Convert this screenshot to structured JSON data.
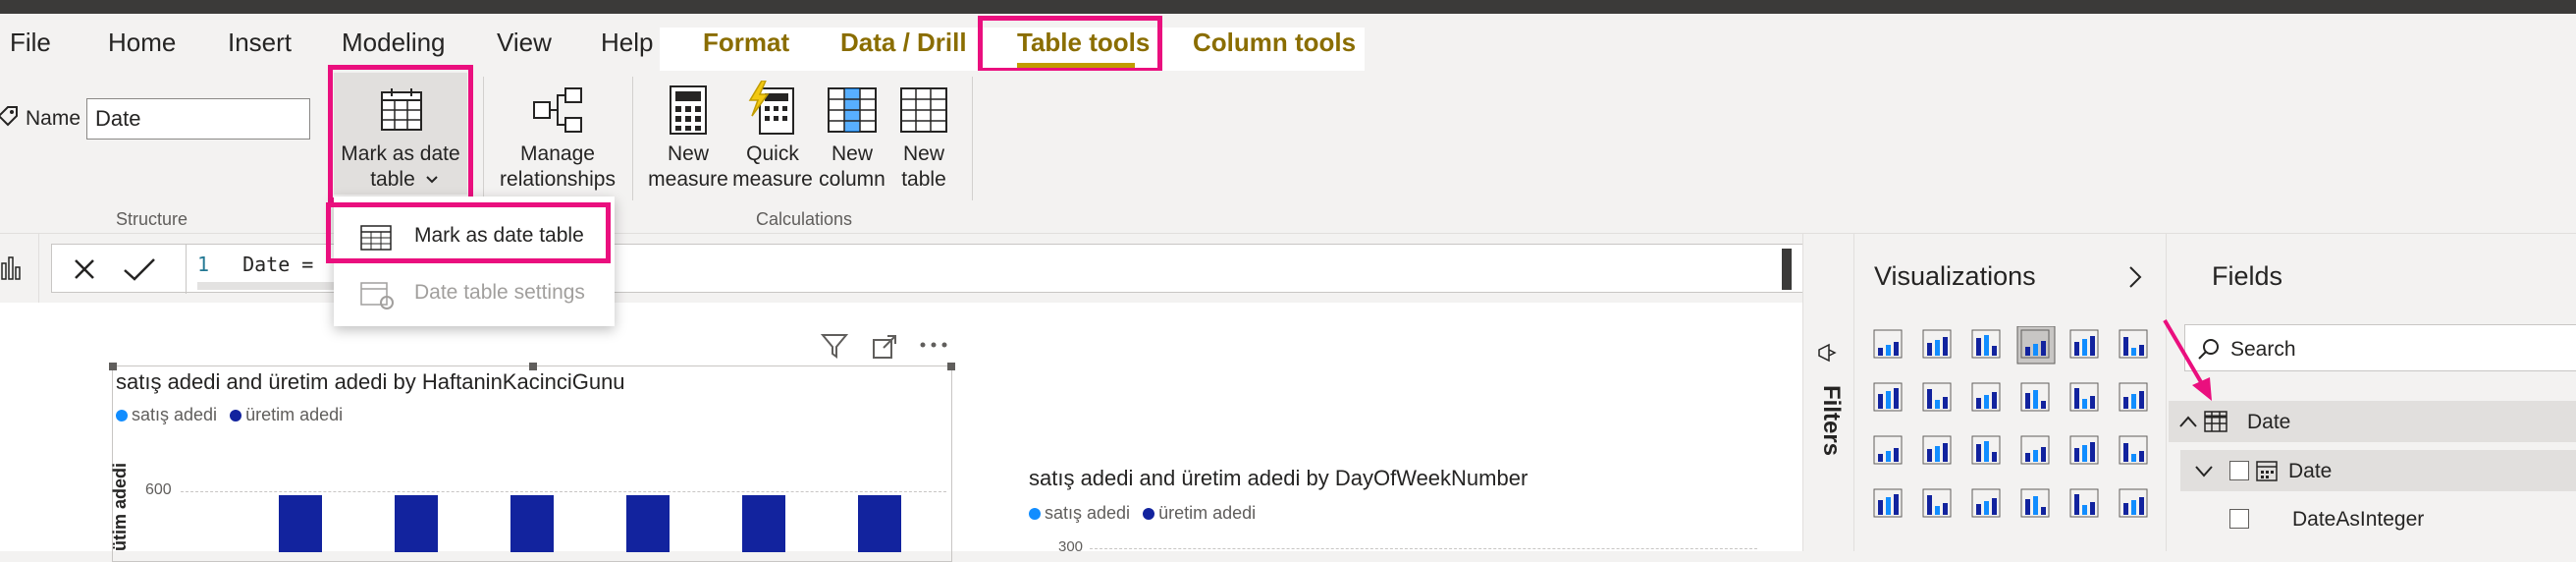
{
  "tabs": {
    "file": "File",
    "home": "Home",
    "insert": "Insert",
    "modeling": "Modeling",
    "view": "View",
    "help": "Help",
    "format": "Format",
    "data_drill": "Data / Drill",
    "table_tools": "Table tools",
    "column_tools": "Column tools"
  },
  "ribbon": {
    "name_label": "Name",
    "name_value": "Date",
    "mark_date_line1": "Mark as date",
    "mark_date_line2": "table",
    "manage_line1": "Manage",
    "manage_line2": "relationships",
    "new_measure_line1": "New",
    "new_measure_line2": "measure",
    "quick_measure_line1": "Quick",
    "quick_measure_line2": "measure",
    "new_column_line1": "New",
    "new_column_line2": "column",
    "new_table_line1": "New",
    "new_table_line2": "table",
    "structure_group": "Structure",
    "calculations_group": "Calculations"
  },
  "dropdown": {
    "mark_as_date_table": "Mark as date table",
    "date_table_settings": "Date table settings"
  },
  "formula": {
    "line1_num": "1",
    "line1_text": "Date ="
  },
  "charts": {
    "chart1_title": "satış adedi and üretim adedi by HaftaninKacinciGunu",
    "chart1_legend_1": "satış adedi",
    "chart1_legend_2": "üretim adedi",
    "chart1_tick": "600",
    "chart1_ylabel": "ütim adedi",
    "chart2_title": "satış adedi and üretim adedi by DayOfWeekNumber",
    "chart2_legend_1": "satış adedi",
    "chart2_legend_2": "üretim adedi",
    "chart2_tick": "300"
  },
  "filters": {
    "label": "Filters"
  },
  "visualizations": {
    "title": "Visualizations"
  },
  "fields": {
    "title": "Fields",
    "search_placeholder": "Search",
    "table_name": "Date",
    "hierarchy_name": "Date",
    "field_1": "DateAsInteger"
  },
  "colors": {
    "accent_highlight": "#ea0f7e",
    "context_tab": "#8a6d00",
    "series_1": "#118dff",
    "series_2": "#12239e"
  },
  "chart_data": [
    {
      "type": "bar",
      "title": "satış adedi and üretim adedi by HaftaninKacinciGunu",
      "ylabel": "ütim adedi",
      "series": [
        {
          "name": "satış adedi",
          "values": []
        },
        {
          "name": "üretim adedi",
          "values": [
            600,
            600,
            600,
            600,
            600,
            600
          ]
        }
      ],
      "ytick_visible": [
        600
      ],
      "legend": "top-left"
    },
    {
      "type": "bar",
      "title": "satış adedi and üretim adedi by DayOfWeekNumber",
      "series": [
        {
          "name": "satış adedi",
          "values": []
        },
        {
          "name": "üretim adedi",
          "values": []
        }
      ],
      "ytick_visible": [
        300
      ],
      "legend": "top-left"
    }
  ]
}
